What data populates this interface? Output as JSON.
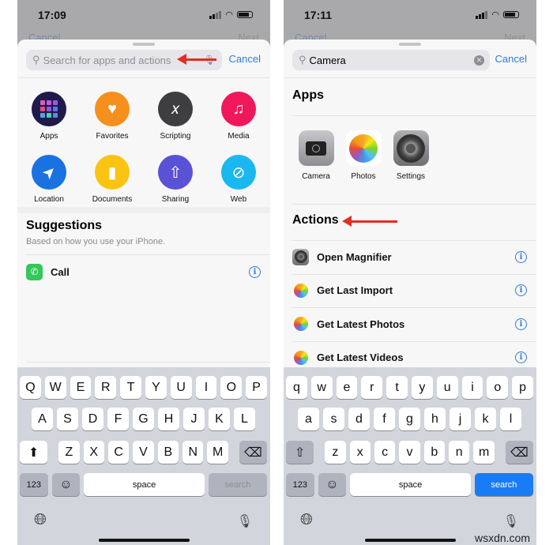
{
  "left": {
    "status": {
      "time": "17:09"
    },
    "behind": {
      "cancel": "Cancel",
      "next": "Next"
    },
    "search": {
      "placeholder": "Search for apps and actions",
      "value": ""
    },
    "cancel": "Cancel",
    "categories": [
      {
        "label": "Apps",
        "icon": "apps-grid-icon",
        "color": "#1e1b4b"
      },
      {
        "label": "Favorites",
        "icon": "heart-icon",
        "color": "#f5901e"
      },
      {
        "label": "Scripting",
        "icon": "scripting-x-icon",
        "color": "#3e3e40"
      },
      {
        "label": "Media",
        "icon": "music-note-icon",
        "color": "#f0185a"
      },
      {
        "label": "Location",
        "icon": "location-arrow-icon",
        "color": "#1a72e0"
      },
      {
        "label": "Documents",
        "icon": "document-icon",
        "color": "#fbc312"
      },
      {
        "label": "Sharing",
        "icon": "share-icon",
        "color": "#5a52d6"
      },
      {
        "label": "Web",
        "icon": "compass-icon",
        "color": "#1bb8f0"
      }
    ],
    "suggestions": {
      "title": "Suggestions",
      "subtitle": "Based on how you use your iPhone.",
      "items": [
        {
          "label": "Call",
          "icon": "phone-icon"
        }
      ]
    },
    "keyboard": {
      "rows": [
        [
          "Q",
          "W",
          "E",
          "R",
          "T",
          "Y",
          "U",
          "I",
          "O",
          "P"
        ],
        [
          "A",
          "S",
          "D",
          "F",
          "G",
          "H",
          "J",
          "K",
          "L"
        ],
        [
          "Z",
          "X",
          "C",
          "V",
          "B",
          "N",
          "M"
        ]
      ],
      "numbers": "123",
      "space": "space",
      "search": "search"
    }
  },
  "right": {
    "status": {
      "time": "17:11"
    },
    "behind": {
      "cancel": "Cancel",
      "next": "Next"
    },
    "search": {
      "value": "Camera"
    },
    "cancel": "Cancel",
    "apps_title": "Apps",
    "apps": [
      {
        "label": "Camera",
        "icon": "camera-icon"
      },
      {
        "label": "Photos",
        "icon": "photos-icon"
      },
      {
        "label": "Settings",
        "icon": "settings-gear-icon"
      }
    ],
    "actions_title": "Actions",
    "actions": [
      {
        "label": "Open Magnifier",
        "icon": "settings-gear-icon"
      },
      {
        "label": "Get Last Import",
        "icon": "photos-icon"
      },
      {
        "label": "Get Latest Photos",
        "icon": "photos-icon"
      },
      {
        "label": "Get Latest Videos",
        "icon": "photos-icon"
      }
    ],
    "keyboard": {
      "rows": [
        [
          "q",
          "w",
          "e",
          "r",
          "t",
          "y",
          "u",
          "i",
          "o",
          "p"
        ],
        [
          "a",
          "s",
          "d",
          "f",
          "g",
          "h",
          "j",
          "k",
          "l"
        ],
        [
          "z",
          "x",
          "c",
          "v",
          "b",
          "n",
          "m"
        ]
      ],
      "numbers": "123",
      "space": "space",
      "search": "search"
    }
  },
  "colors": {
    "accent": "#2f7bd8",
    "arrow": "#e0301e",
    "search_key_active": "#1a7cf5"
  },
  "watermark": "wsxdn.com"
}
